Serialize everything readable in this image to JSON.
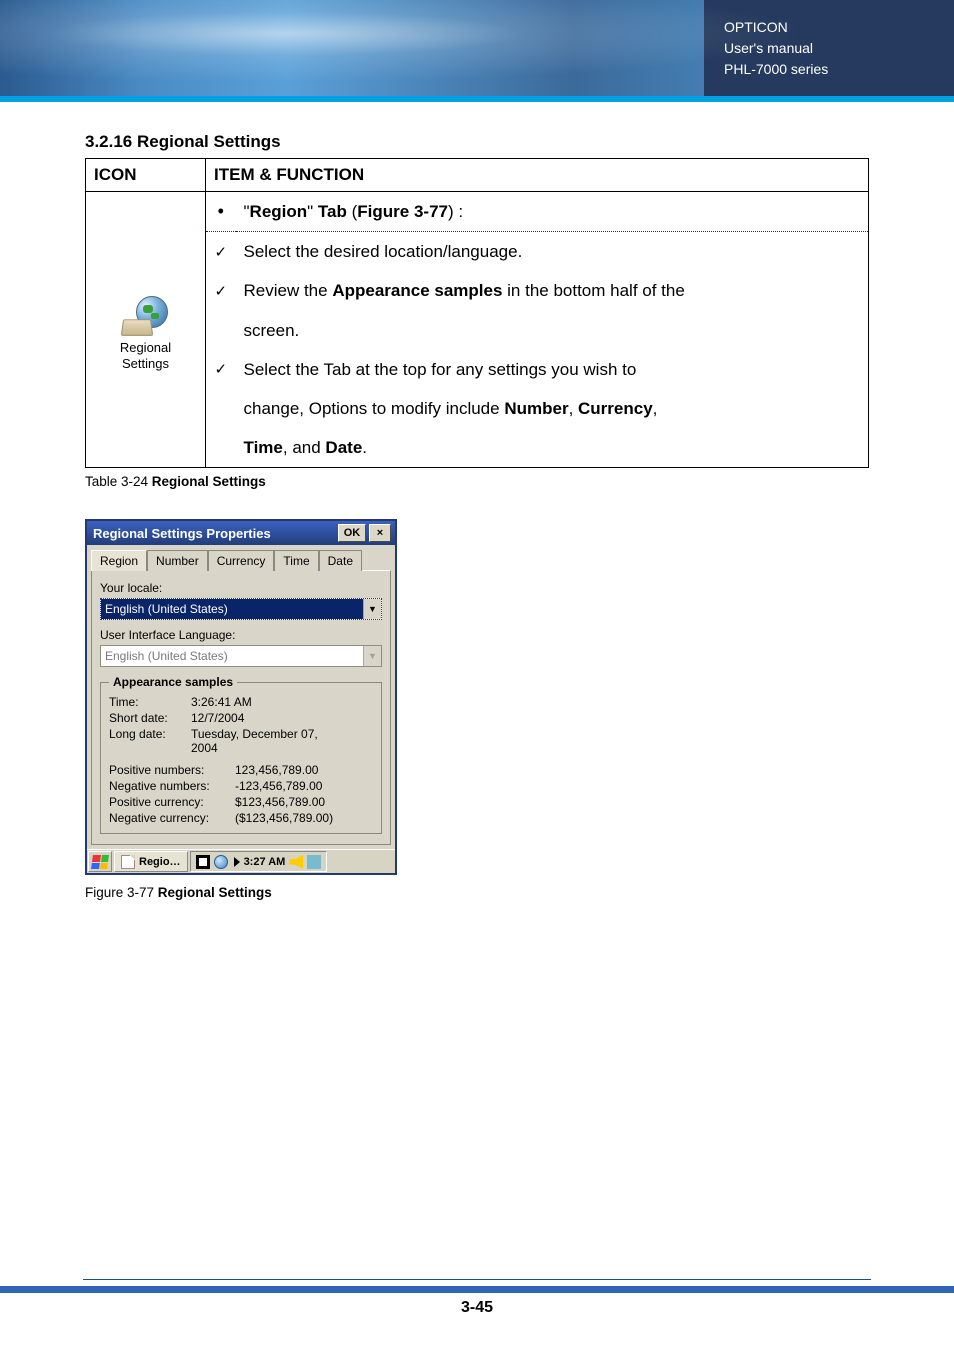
{
  "header": {
    "line1": "OPTICON",
    "line2": "User's manual",
    "line3": "PHL-7000 series"
  },
  "section_title": "3.2.16 Regional Settings",
  "table": {
    "head": {
      "col1": "ICON",
      "col2": "ITEM & FUNCTION"
    },
    "icon_caption_1": "Regional",
    "icon_caption_2": "Settings",
    "rows": {
      "region_tab": "\"Region\" Tab (Figure 3-77) :",
      "r1": "Select the desired location/language.",
      "r2a": "Review the ",
      "r2a_bold": "Appearance samples",
      "r2a_tail": " in the bottom half of the",
      "r2b": "screen.",
      "r3a": "Select the Tab at the top for any settings you wish to",
      "r3b_head": "change, Options to modify include ",
      "r3b_b1": "Number",
      "r3b_sep1": ", ",
      "r3b_b2": "Currency",
      "r3b_tail": ",",
      "r3c_b1": "Time",
      "r3c_mid": ", and ",
      "r3c_b2": "Date",
      "r3c_tail": "."
    }
  },
  "table_caption_prefix": "Table 3-24 ",
  "table_caption_bold": "Regional Settings",
  "win": {
    "title": "Regional Settings Properties",
    "ok_label": "OK",
    "close_label": "×",
    "tabs": {
      "t1": "Region",
      "t2": "Number",
      "t3": "Currency",
      "t4": "Time",
      "t5": "Date"
    },
    "labels": {
      "locale": "Your locale:",
      "uilang": "User Interface Language:",
      "legend": "Appearance samples",
      "time": "Time:",
      "short": "Short date:",
      "long": "Long date:",
      "posnum": "Positive numbers:",
      "negnum": "Negative numbers:",
      "poscur": "Positive currency:",
      "negcur": "Negative currency:"
    },
    "values": {
      "locale": "English (United States)",
      "uilang": "English (United States)",
      "time": "3:26:41 AM",
      "short": "12/7/2004",
      "long_1": "Tuesday, December 07,",
      "long_2": "2004",
      "posnum": "123,456,789.00",
      "negnum": "-123,456,789.00",
      "poscur": "$123,456,789.00",
      "negcur": "($123,456,789.00)"
    },
    "task": {
      "btn": "Regio…",
      "time": "3:27 AM"
    }
  },
  "figure_caption_prefix": "Figure 3-77 ",
  "figure_caption_bold": "Regional Settings",
  "page_number": "3-45"
}
